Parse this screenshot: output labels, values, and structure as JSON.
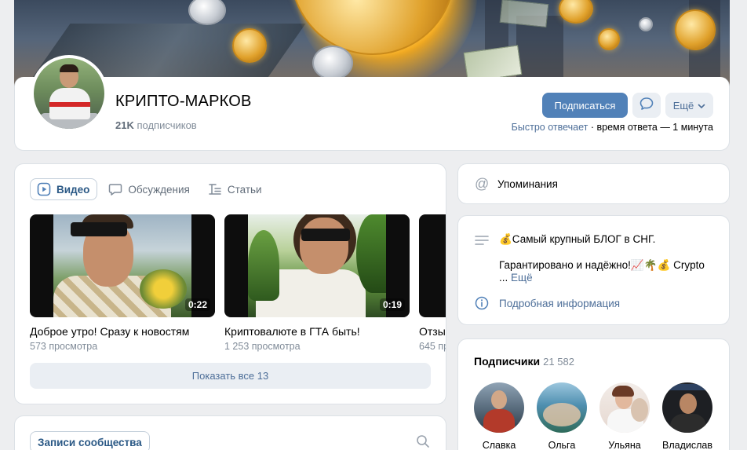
{
  "group": {
    "name": "КРИПТО-МАРКОВ",
    "subscribers_count": "21K",
    "subscribers_label": "подписчиков"
  },
  "actions": {
    "subscribe_label": "Подписаться",
    "more_label": "Ещё",
    "reply_fast": "Быстро отвечает",
    "reply_time": " · время ответа — 1 минута"
  },
  "tabs": [
    {
      "label": "Видео",
      "icon": "play-icon",
      "active": true
    },
    {
      "label": "Обсуждения",
      "icon": "chat-icon",
      "active": false
    },
    {
      "label": "Статьи",
      "icon": "article-icon",
      "active": false
    }
  ],
  "videos": [
    {
      "title": "Доброе утро! Сразу к новостям",
      "views": "573 просмотра",
      "duration": "0:22"
    },
    {
      "title": "Криптовалюте в ГТА быть!",
      "views": "1 253 просмотра",
      "duration": "0:19"
    },
    {
      "title": "Отзы",
      "views": "645 пр",
      "duration": ""
    }
  ],
  "show_all_label": "Показать все 13",
  "posts": {
    "label": "Записи сообщества"
  },
  "mentions": {
    "label": "Упоминания"
  },
  "about": {
    "line1": "💰Самый крупный БЛОГ в СНГ.",
    "line2": "Гарантировано и надёжно!📈🌴💰 Crypto",
    "ellipsis": "... ",
    "more_label": "Ещё",
    "details_label": "Подробная информация"
  },
  "followers": {
    "title": "Подписчики",
    "count": "21 582",
    "items": [
      {
        "name": "Славка"
      },
      {
        "name": "Ольга"
      },
      {
        "name": "Ульяна"
      },
      {
        "name": "Владислав"
      }
    ]
  },
  "colors": {
    "accent": "#5181b8",
    "link": "#4e6f99",
    "secondary_text": "#818c99",
    "page_bg": "#edeef0"
  }
}
